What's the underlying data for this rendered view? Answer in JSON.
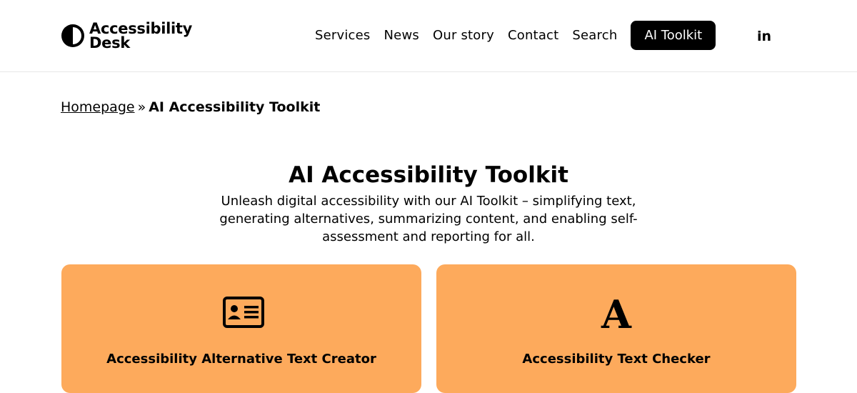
{
  "logo": {
    "line1": "Accessibility",
    "line2": "Desk"
  },
  "nav": {
    "items": [
      {
        "label": "Services"
      },
      {
        "label": "News"
      },
      {
        "label": "Our story"
      },
      {
        "label": "Contact"
      },
      {
        "label": "Search"
      }
    ],
    "cta_label": "AI Toolkit",
    "social_label": "in"
  },
  "breadcrumb": {
    "home": "Homepage",
    "separator": "»",
    "current": "AI Accessibility Toolkit"
  },
  "hero": {
    "title": "AI Accessibility Toolkit",
    "description": "Unleash digital accessibility with our AI Toolkit – simplifying text, generating alternatives, summarizing content, and enabling self-assessment and reporting for all."
  },
  "cards": [
    {
      "title": "Accessibility Alternative Text Creator",
      "icon": "id-card-icon"
    },
    {
      "title": "Accessibility Text Checker",
      "icon": "letter-a-icon",
      "icon_glyph": "A"
    }
  ],
  "colors": {
    "card_bg": "#fdaa5c",
    "cta_bg": "#000000",
    "text": "#000000"
  }
}
